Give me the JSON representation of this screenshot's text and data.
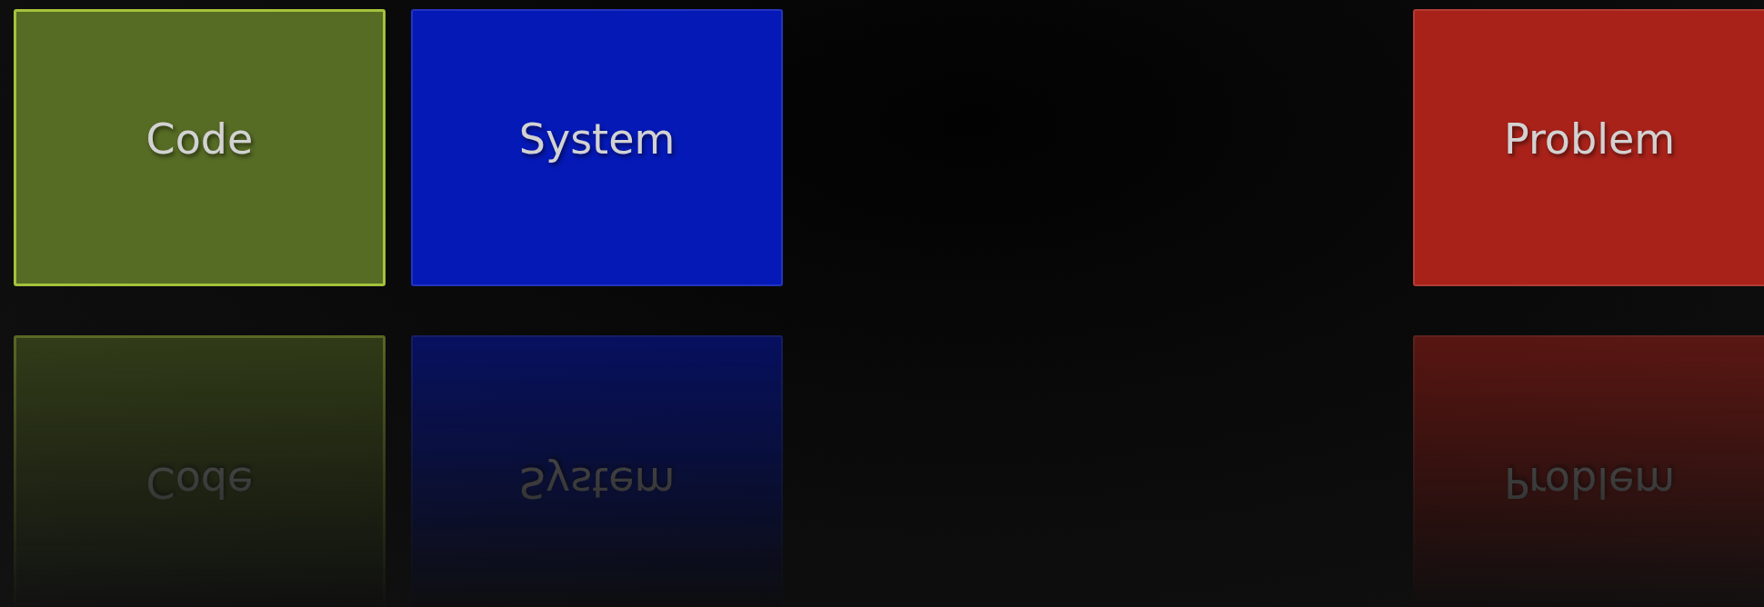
{
  "tiles": [
    {
      "label": "Code",
      "color": "#566b24",
      "selected": true
    },
    {
      "label": "System",
      "color": "#0519b6",
      "selected": false
    },
    {
      "label": "Problem",
      "color": "#a8221a",
      "selected": false
    }
  ]
}
